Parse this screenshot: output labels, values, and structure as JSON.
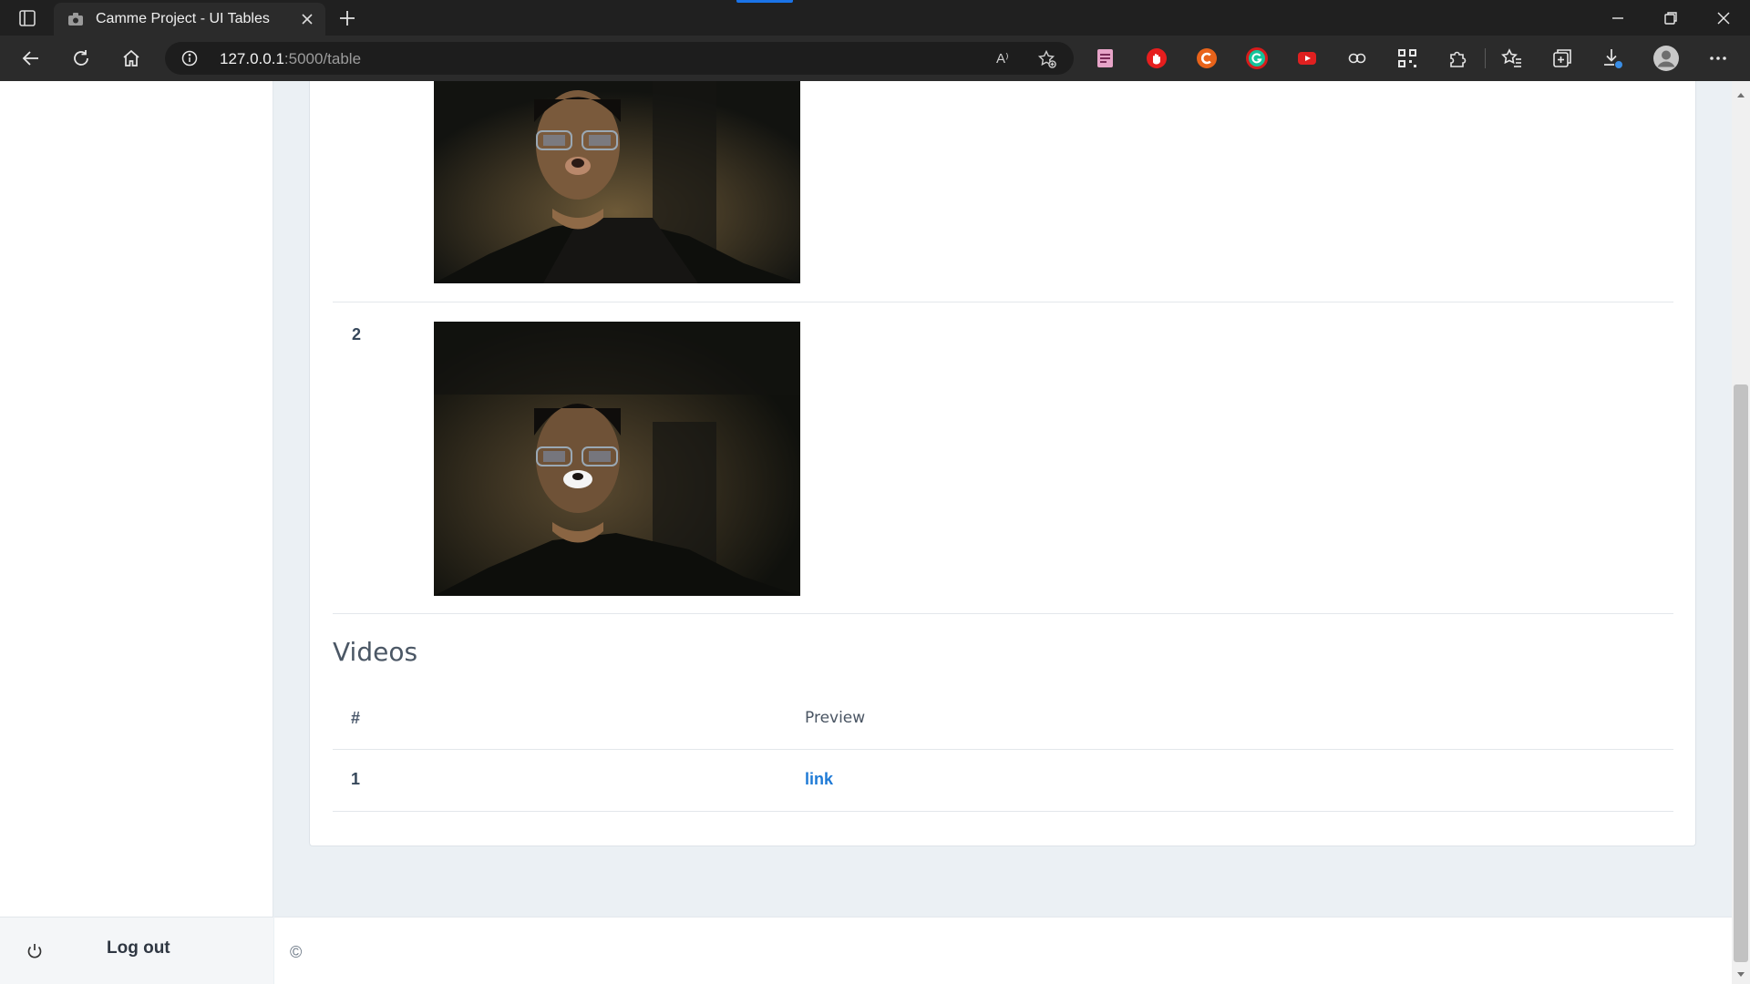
{
  "browser": {
    "tab_title": "Camme Project - UI Tables",
    "url_host": "127.0.0.1",
    "url_rest": ":5000/table",
    "read_aloud_label": "A⁾"
  },
  "images": {
    "rows": [
      {
        "index": ""
      },
      {
        "index": "2"
      }
    ]
  },
  "videos": {
    "title": "Videos",
    "headers": {
      "index": "#",
      "preview": "Preview"
    },
    "rows": [
      {
        "index": "1",
        "link": "link"
      }
    ]
  },
  "sidebar": {
    "logout_label": "Log out"
  },
  "footer": {
    "copyright": "©"
  },
  "colors": {
    "link": "#1f7ad6",
    "page_bg": "#ebf0f4",
    "chrome_dark": "#202020"
  }
}
